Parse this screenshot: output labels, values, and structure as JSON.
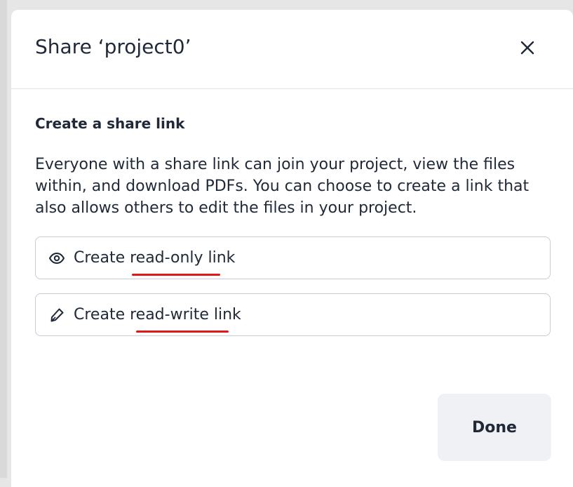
{
  "dialog": {
    "title": "Share ‘project0’",
    "close_icon": "close-icon"
  },
  "section": {
    "title": "Create a share link",
    "description": "Everyone with a share link can join your project, view the files within, and download PDFs. You can choose to create a link that also allows others to edit the files in your project."
  },
  "buttons": {
    "read_only": {
      "icon": "eye-icon",
      "label": "Create read-only link"
    },
    "read_write": {
      "icon": "pencil-icon",
      "label": "Create read-write link"
    },
    "done": "Done"
  },
  "colors": {
    "annotation_underline": "#e01818",
    "text": "#1f2937",
    "border": "#c9ccd6",
    "done_bg": "#f0f1f4"
  }
}
